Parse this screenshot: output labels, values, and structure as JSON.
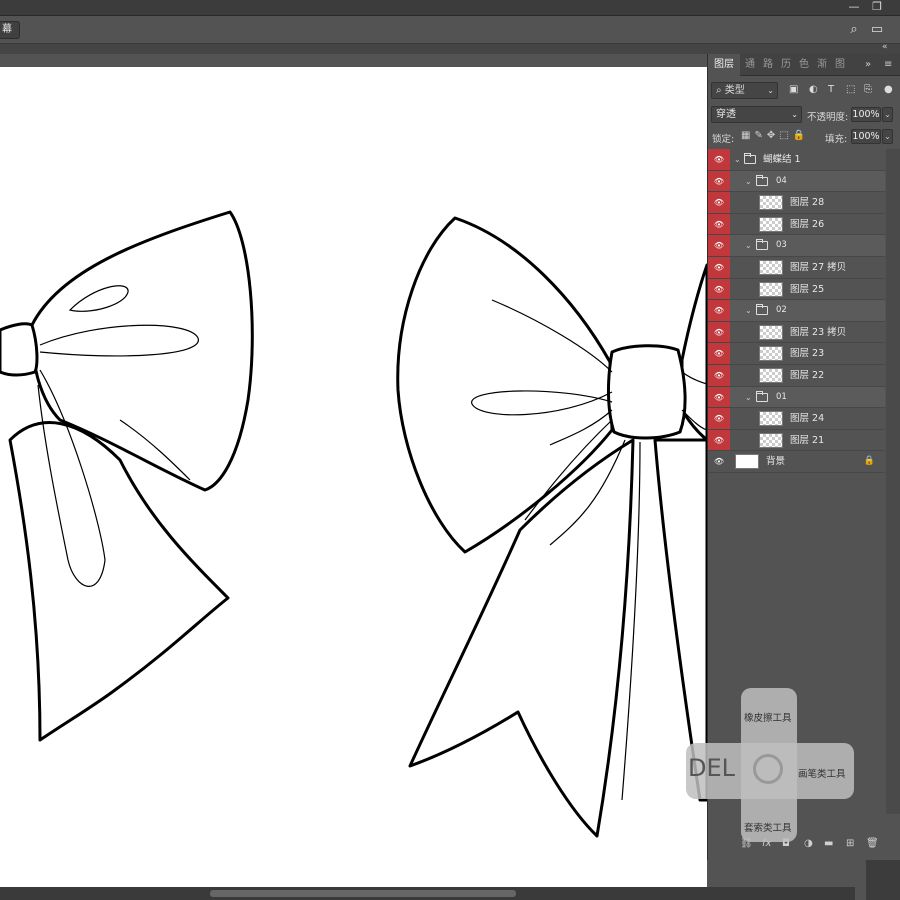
{
  "window": {
    "minimize": "—",
    "restore": "❐"
  },
  "options_bar": {
    "screen_chip": "幕",
    "search_icon": "search-icon",
    "workspace_icon": "workspace-icon"
  },
  "panel": {
    "tabs": [
      {
        "label": "图层"
      },
      {
        "label": "通"
      },
      {
        "label": "路"
      },
      {
        "label": "历"
      },
      {
        "label": "色"
      },
      {
        "label": "渐"
      },
      {
        "label": "图"
      }
    ],
    "overflow": "»",
    "menu": "≡",
    "filter_label": "类型",
    "blend_mode": "穿透",
    "opacity_label": "不透明度:",
    "opacity_value": "100%",
    "lock_label": "锁定:",
    "fill_label": "填充:",
    "fill_value": "100%",
    "layers": [
      {
        "name": "蝴蝶结 1",
        "kind": "group",
        "depth": 0
      },
      {
        "name": "04",
        "kind": "group",
        "depth": 1
      },
      {
        "name": "图层 28",
        "kind": "layer",
        "depth": 2
      },
      {
        "name": "图层 26",
        "kind": "layer",
        "depth": 2
      },
      {
        "name": "03",
        "kind": "group",
        "depth": 1
      },
      {
        "name": "图层 27 拷贝",
        "kind": "layer",
        "depth": 2
      },
      {
        "name": "图层 25",
        "kind": "layer",
        "depth": 2
      },
      {
        "name": "02",
        "kind": "group",
        "depth": 1
      },
      {
        "name": "图层 23 拷贝",
        "kind": "layer",
        "depth": 2
      },
      {
        "name": "图层 23",
        "kind": "layer",
        "depth": 2
      },
      {
        "name": "图层 22",
        "kind": "layer",
        "depth": 2
      },
      {
        "name": "01",
        "kind": "group",
        "depth": 1
      },
      {
        "name": "图层 24",
        "kind": "layer",
        "depth": 2
      },
      {
        "name": "图层 21",
        "kind": "layer",
        "depth": 2
      },
      {
        "name": "背景",
        "kind": "background",
        "depth": 0
      }
    ],
    "bottom_icons": [
      "link-icon",
      "fx",
      "mask-icon",
      "adjustment-icon",
      "folder-icon",
      "new-layer-icon",
      "trash-icon"
    ]
  },
  "shortcut_pad": {
    "top": "橡皮擦工具",
    "right": "画笔类工具",
    "bottom": "套索类工具",
    "left": "DEL"
  }
}
